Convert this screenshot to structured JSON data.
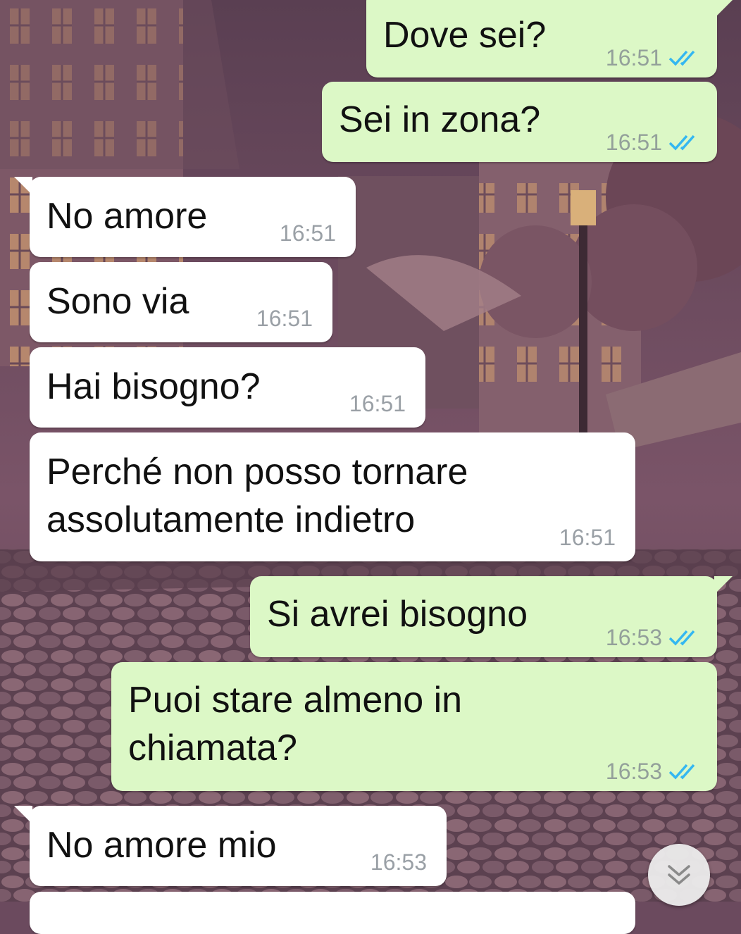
{
  "colors": {
    "outgoing_bubble": "#dcf8c6",
    "incoming_bubble": "#ffffff",
    "read_ticks": "#34b7f1",
    "timestamp": "#93a09a"
  },
  "messages": [
    {
      "direction": "out",
      "text": "Dove sei?",
      "time": "16:51",
      "status": "read-double-tick-icon"
    },
    {
      "direction": "out",
      "text": "Sei in zona?",
      "time": "16:51",
      "status": "read-double-tick-icon"
    },
    {
      "direction": "in",
      "text": "No amore",
      "time": "16:51"
    },
    {
      "direction": "in",
      "text": "Sono via",
      "time": "16:51"
    },
    {
      "direction": "in",
      "text": "Hai bisogno?",
      "time": "16:51"
    },
    {
      "direction": "in",
      "text": "Perché non posso tornare\nassolutamente indietro",
      "time": "16:51"
    },
    {
      "direction": "out",
      "text": "Si avrei bisogno",
      "time": "16:53",
      "status": "read-double-tick-icon"
    },
    {
      "direction": "out",
      "text": "Puoi stare almeno in\nchiamata?",
      "time": "16:53",
      "status": "read-double-tick-icon"
    },
    {
      "direction": "in",
      "text": "No amore mio",
      "time": "16:53"
    }
  ],
  "scroll_button": {
    "icon": "double-chevron-down-icon"
  }
}
